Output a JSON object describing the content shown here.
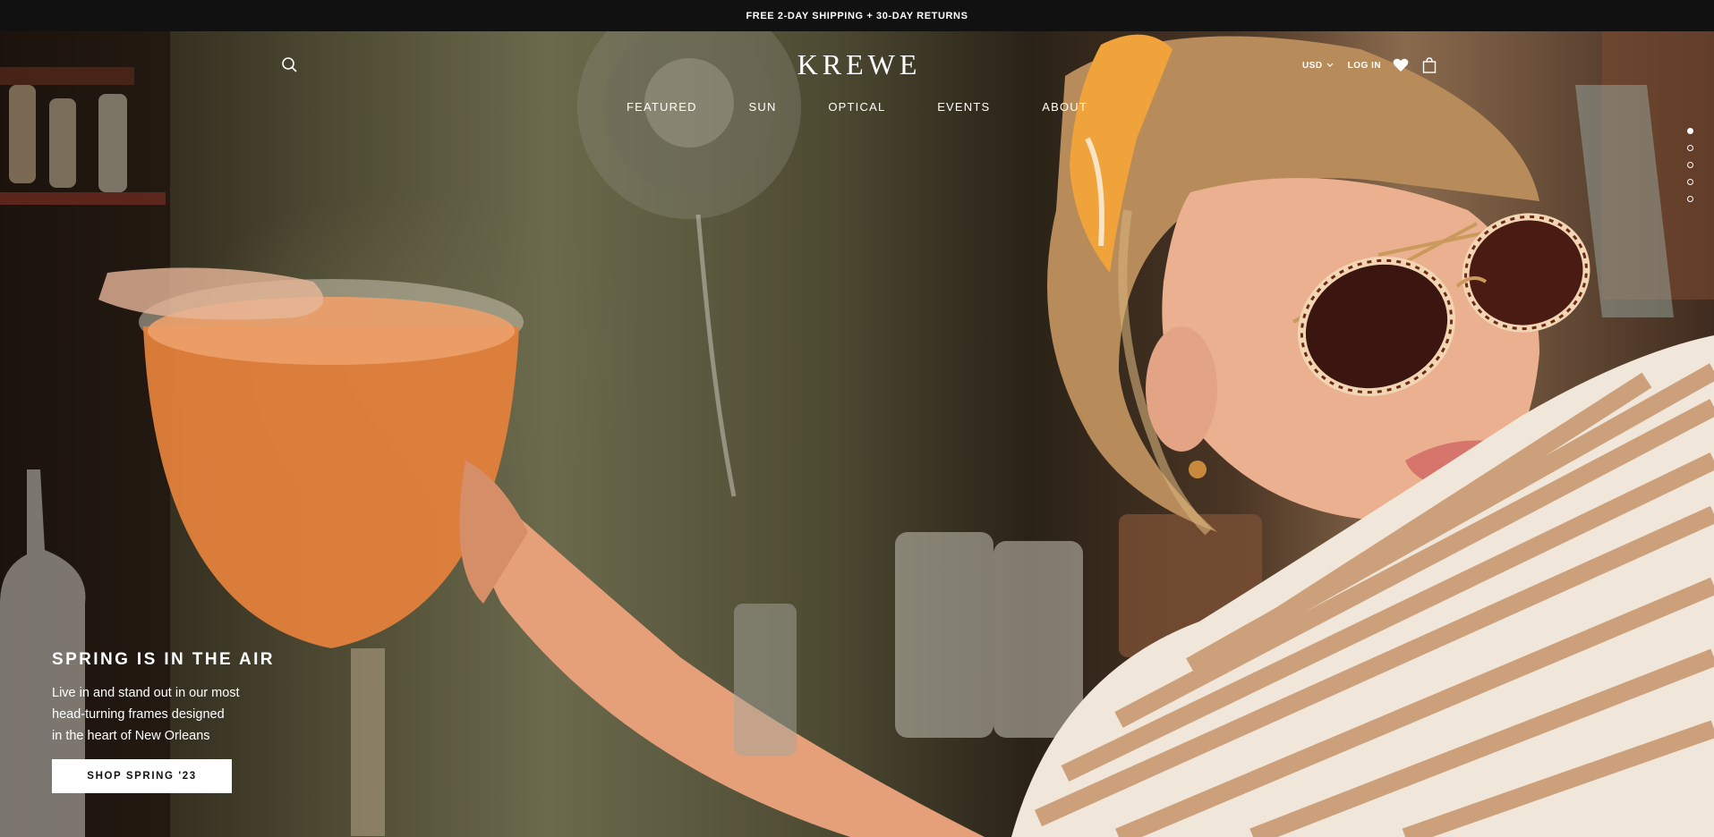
{
  "announcement": "FREE 2-DAY SHIPPING + 30-DAY RETURNS",
  "header": {
    "logo": "KREWE",
    "search_icon": "search-icon",
    "nav": [
      "FEATURED",
      "SUN",
      "OPTICAL",
      "EVENTS",
      "ABOUT"
    ],
    "currency": "USD",
    "login": "LOG IN",
    "wishlist_icon": "heart-icon",
    "cart_icon": "shopping-bag-icon"
  },
  "slider": {
    "active_index": 0,
    "dots": 5
  },
  "hero": {
    "heading": "SPRING IS IN THE AIR",
    "body": [
      "Live in and stand out in our most",
      "head-turning frames designed",
      "in the heart of New Orleans"
    ],
    "cta": "SHOP SPRING '23"
  },
  "colors": {
    "announcement_bg": "#111111",
    "text_light": "#ffffff",
    "cta_bg": "#ffffff",
    "cta_text": "#111111"
  }
}
